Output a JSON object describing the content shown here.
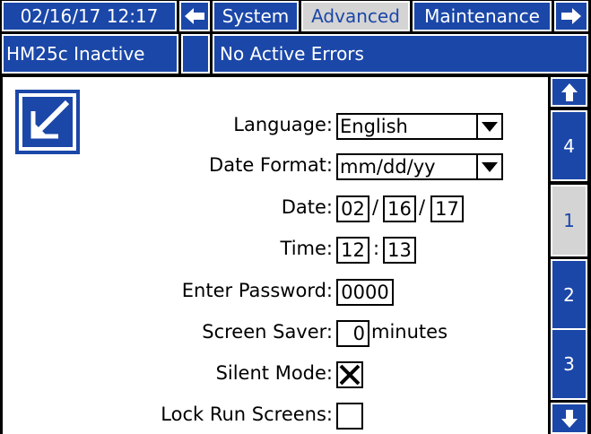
{
  "header": {
    "datetime": "02/16/17 12:17",
    "tabs": [
      {
        "label": "System",
        "active": false
      },
      {
        "label": "Advanced",
        "active": true
      },
      {
        "label": "Maintenance",
        "active": false
      }
    ],
    "status": "HM25c Inactive",
    "errors": "No Active Errors"
  },
  "form": {
    "language": {
      "label": "Language:",
      "value": "English"
    },
    "date_format": {
      "label": "Date Format:",
      "value": "mm/dd/yy"
    },
    "date": {
      "label": "Date:",
      "month": "02",
      "day": "16",
      "year": "17",
      "sep": "/"
    },
    "time": {
      "label": "Time:",
      "hour": "12",
      "minute": "13",
      "sep": ":"
    },
    "password": {
      "label": "Enter Password:",
      "value": "0000"
    },
    "screen_saver": {
      "label": "Screen Saver:",
      "value": "0",
      "unit": "minutes"
    },
    "silent_mode": {
      "label": "Silent Mode:",
      "checked": true
    },
    "lock_run_screens": {
      "label": "Lock Run Screens:",
      "checked": false
    }
  },
  "pages": [
    {
      "label": "4",
      "active": false
    },
    {
      "label": "1",
      "active": true
    },
    {
      "label": "2",
      "active": false
    },
    {
      "label": "3",
      "active": false
    }
  ],
  "colors": {
    "accent_blue": "#1b47a8",
    "inactive_grey": "#d4d4d4"
  }
}
